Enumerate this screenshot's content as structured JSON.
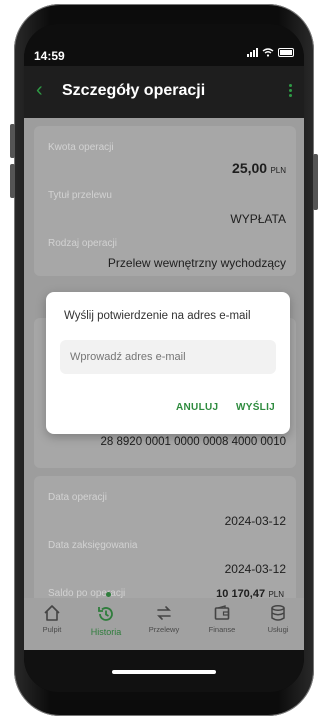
{
  "status": {
    "time": "14:59"
  },
  "header": {
    "title": "Szczegóły operacji"
  },
  "details": {
    "amount_label": "Kwota operacji",
    "amount_value": "25,00",
    "amount_currency": "PLN",
    "transfer_title_label": "Tytuł przelewu",
    "transfer_title_value": "WYPŁATA",
    "operation_type_label": "Rodzaj operacji",
    "operation_type_value": "Przelew wewnętrzny wychodzący",
    "account_value": "28 8920 0001 0000 0008 4000 0010",
    "operation_date_label": "Data operacji",
    "operation_date_value": "2024-03-12",
    "booking_date_label": "Data zaksięgowania",
    "booking_date_value": "2024-03-12",
    "balance_label": "Saldo po operacji",
    "balance_value": "10 170,47",
    "balance_currency": "PLN"
  },
  "dialog": {
    "title": "Wyślij potwierdzenie na adres e-mail",
    "email_placeholder": "Wprowadź adres e-mail",
    "cancel_label": "ANULUJ",
    "send_label": "WYŚLIJ"
  },
  "nav": {
    "items": [
      {
        "label": "Pulpit",
        "icon": "home-icon"
      },
      {
        "label": "Historia",
        "icon": "history-icon"
      },
      {
        "label": "Przelewy",
        "icon": "transfer-icon"
      },
      {
        "label": "Finanse",
        "icon": "finance-icon"
      },
      {
        "label": "Usługi",
        "icon": "services-icon"
      }
    ],
    "active_index": 1
  },
  "colors": {
    "accent": "#2e9b45",
    "header_bg": "#1e1e1e",
    "overlay_content": "#9d9d9d"
  }
}
